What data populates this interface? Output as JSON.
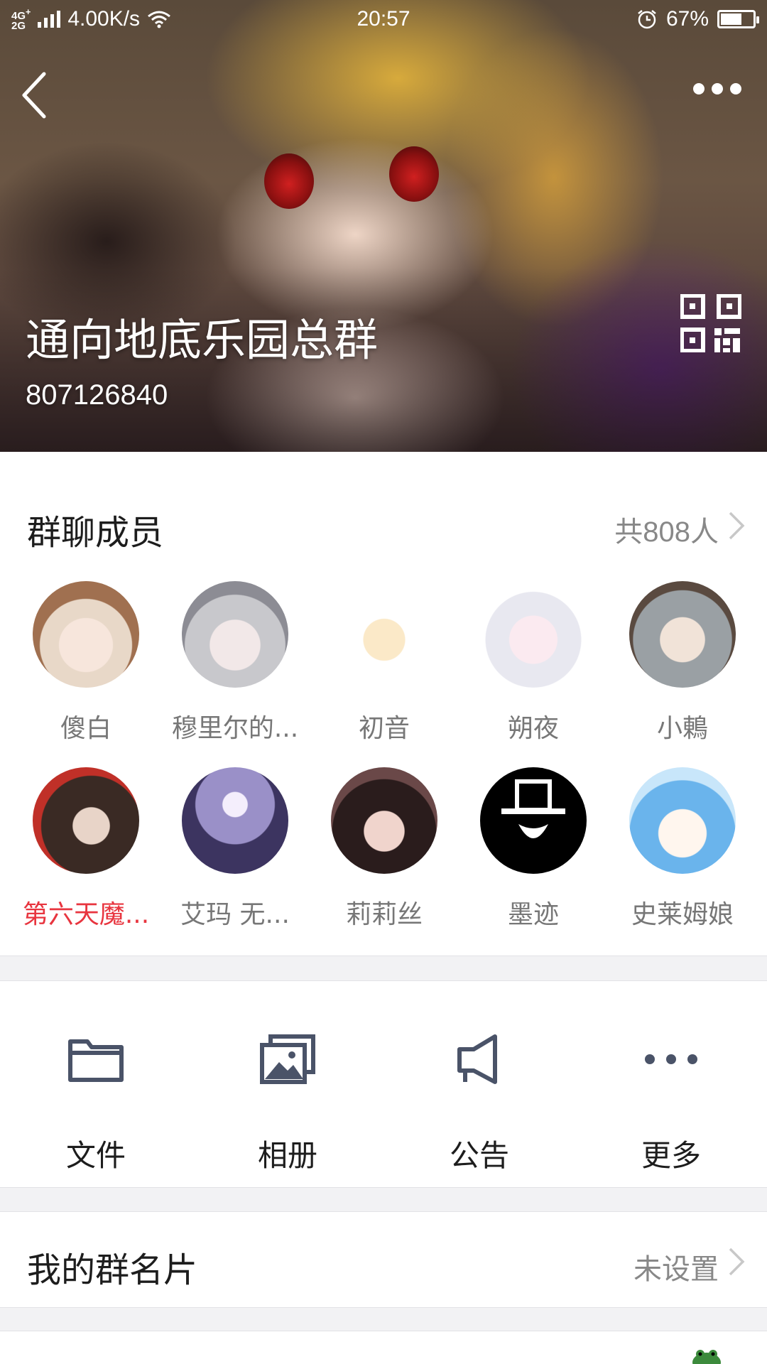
{
  "status_bar": {
    "network": "4G+\n2G",
    "speed": "4.00K/s",
    "time": "20:57",
    "battery": "67%",
    "battery_level": 0.67
  },
  "header": {
    "group_name": "通向地底乐园总群",
    "group_id": "807126840"
  },
  "members": {
    "title": "群聊成员",
    "count_label": "共808人",
    "items": [
      {
        "name": "傻白",
        "highlight": false
      },
      {
        "name": "穆里尔的...",
        "highlight": false
      },
      {
        "name": "初音",
        "highlight": false
      },
      {
        "name": "朔夜",
        "highlight": false
      },
      {
        "name": "小鶇",
        "highlight": false
      },
      {
        "name": "第六天魔...",
        "highlight": true
      },
      {
        "name": "艾玛 无...",
        "highlight": false
      },
      {
        "name": "莉莉丝",
        "highlight": false
      },
      {
        "name": "墨迹",
        "highlight": false
      },
      {
        "name": "史莱姆娘",
        "highlight": false
      }
    ]
  },
  "actions": {
    "files": "文件",
    "album": "相册",
    "notice": "公告",
    "more": "更多"
  },
  "group_card": {
    "label": "我的群名片",
    "value": "未设置"
  },
  "colors": {
    "highlight_name": "#e8353f",
    "icon": "#4a5368",
    "secondary_text": "#888888"
  }
}
